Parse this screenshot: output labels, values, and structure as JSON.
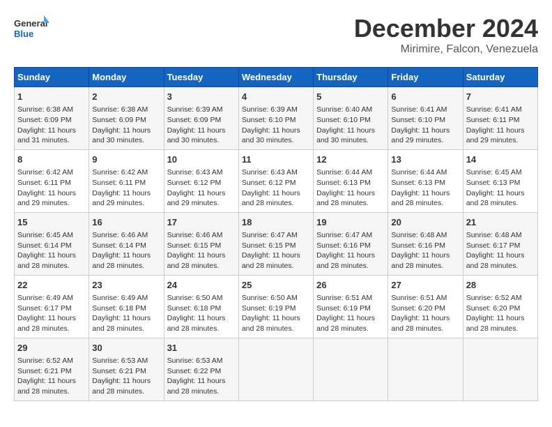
{
  "logo": {
    "line1": "General",
    "line2": "Blue"
  },
  "title": "December 2024",
  "location": "Mirimire, Falcon, Venezuela",
  "weekdays": [
    "Sunday",
    "Monday",
    "Tuesday",
    "Wednesday",
    "Thursday",
    "Friday",
    "Saturday"
  ],
  "weeks": [
    [
      {
        "day": "1",
        "sunrise": "6:38 AM",
        "sunset": "6:09 PM",
        "daylight": "11 hours and 31 minutes."
      },
      {
        "day": "2",
        "sunrise": "6:38 AM",
        "sunset": "6:09 PM",
        "daylight": "11 hours and 30 minutes."
      },
      {
        "day": "3",
        "sunrise": "6:39 AM",
        "sunset": "6:09 PM",
        "daylight": "11 hours and 30 minutes."
      },
      {
        "day": "4",
        "sunrise": "6:39 AM",
        "sunset": "6:10 PM",
        "daylight": "11 hours and 30 minutes."
      },
      {
        "day": "5",
        "sunrise": "6:40 AM",
        "sunset": "6:10 PM",
        "daylight": "11 hours and 30 minutes."
      },
      {
        "day": "6",
        "sunrise": "6:41 AM",
        "sunset": "6:10 PM",
        "daylight": "11 hours and 29 minutes."
      },
      {
        "day": "7",
        "sunrise": "6:41 AM",
        "sunset": "6:11 PM",
        "daylight": "11 hours and 29 minutes."
      }
    ],
    [
      {
        "day": "8",
        "sunrise": "6:42 AM",
        "sunset": "6:11 PM",
        "daylight": "11 hours and 29 minutes."
      },
      {
        "day": "9",
        "sunrise": "6:42 AM",
        "sunset": "6:11 PM",
        "daylight": "11 hours and 29 minutes."
      },
      {
        "day": "10",
        "sunrise": "6:43 AM",
        "sunset": "6:12 PM",
        "daylight": "11 hours and 29 minutes."
      },
      {
        "day": "11",
        "sunrise": "6:43 AM",
        "sunset": "6:12 PM",
        "daylight": "11 hours and 28 minutes."
      },
      {
        "day": "12",
        "sunrise": "6:44 AM",
        "sunset": "6:13 PM",
        "daylight": "11 hours and 28 minutes."
      },
      {
        "day": "13",
        "sunrise": "6:44 AM",
        "sunset": "6:13 PM",
        "daylight": "11 hours and 28 minutes."
      },
      {
        "day": "14",
        "sunrise": "6:45 AM",
        "sunset": "6:13 PM",
        "daylight": "11 hours and 28 minutes."
      }
    ],
    [
      {
        "day": "15",
        "sunrise": "6:45 AM",
        "sunset": "6:14 PM",
        "daylight": "11 hours and 28 minutes."
      },
      {
        "day": "16",
        "sunrise": "6:46 AM",
        "sunset": "6:14 PM",
        "daylight": "11 hours and 28 minutes."
      },
      {
        "day": "17",
        "sunrise": "6:46 AM",
        "sunset": "6:15 PM",
        "daylight": "11 hours and 28 minutes."
      },
      {
        "day": "18",
        "sunrise": "6:47 AM",
        "sunset": "6:15 PM",
        "daylight": "11 hours and 28 minutes."
      },
      {
        "day": "19",
        "sunrise": "6:47 AM",
        "sunset": "6:16 PM",
        "daylight": "11 hours and 28 minutes."
      },
      {
        "day": "20",
        "sunrise": "6:48 AM",
        "sunset": "6:16 PM",
        "daylight": "11 hours and 28 minutes."
      },
      {
        "day": "21",
        "sunrise": "6:48 AM",
        "sunset": "6:17 PM",
        "daylight": "11 hours and 28 minutes."
      }
    ],
    [
      {
        "day": "22",
        "sunrise": "6:49 AM",
        "sunset": "6:17 PM",
        "daylight": "11 hours and 28 minutes."
      },
      {
        "day": "23",
        "sunrise": "6:49 AM",
        "sunset": "6:18 PM",
        "daylight": "11 hours and 28 minutes."
      },
      {
        "day": "24",
        "sunrise": "6:50 AM",
        "sunset": "6:18 PM",
        "daylight": "11 hours and 28 minutes."
      },
      {
        "day": "25",
        "sunrise": "6:50 AM",
        "sunset": "6:19 PM",
        "daylight": "11 hours and 28 minutes."
      },
      {
        "day": "26",
        "sunrise": "6:51 AM",
        "sunset": "6:19 PM",
        "daylight": "11 hours and 28 minutes."
      },
      {
        "day": "27",
        "sunrise": "6:51 AM",
        "sunset": "6:20 PM",
        "daylight": "11 hours and 28 minutes."
      },
      {
        "day": "28",
        "sunrise": "6:52 AM",
        "sunset": "6:20 PM",
        "daylight": "11 hours and 28 minutes."
      }
    ],
    [
      {
        "day": "29",
        "sunrise": "6:52 AM",
        "sunset": "6:21 PM",
        "daylight": "11 hours and 28 minutes."
      },
      {
        "day": "30",
        "sunrise": "6:53 AM",
        "sunset": "6:21 PM",
        "daylight": "11 hours and 28 minutes."
      },
      {
        "day": "31",
        "sunrise": "6:53 AM",
        "sunset": "6:22 PM",
        "daylight": "11 hours and 28 minutes."
      },
      null,
      null,
      null,
      null
    ]
  ]
}
